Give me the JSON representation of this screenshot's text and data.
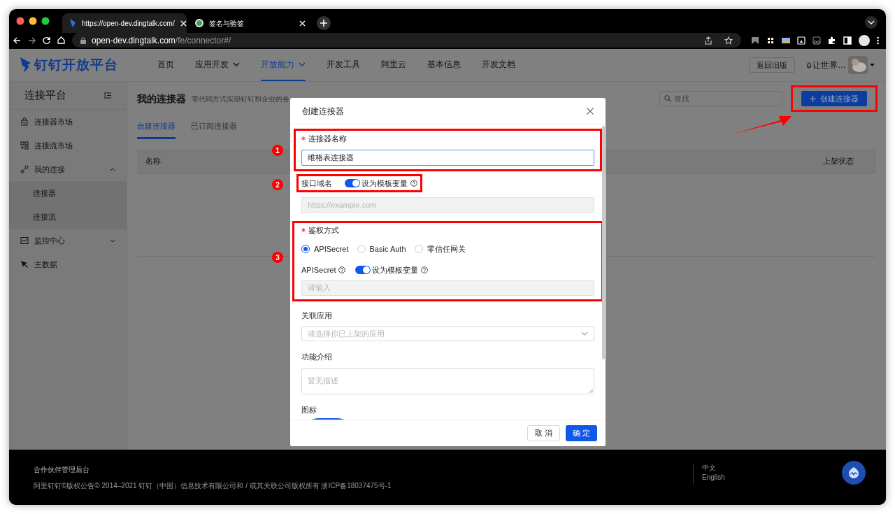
{
  "browser": {
    "tabs": [
      {
        "title": "https://open-dev.dingtalk.com/",
        "selected": true
      },
      {
        "title": "签名与验签",
        "selected": false
      }
    ],
    "url": {
      "host": "open-dev.dingtalk.com",
      "path": "/fe/connector#/"
    }
  },
  "header": {
    "logo": "钉钉开放平台",
    "nav": [
      {
        "label": "首页",
        "caret": false,
        "selected": false
      },
      {
        "label": "应用开发",
        "caret": true,
        "selected": false
      },
      {
        "label": "开放能力",
        "caret": true,
        "selected": true
      },
      {
        "label": "开发工具",
        "caret": false,
        "selected": false
      },
      {
        "label": "阿里云",
        "caret": false,
        "selected": false
      },
      {
        "label": "基本信息",
        "caret": false,
        "selected": false
      },
      {
        "label": "开发文档",
        "caret": false,
        "selected": false
      }
    ],
    "old_version_button": "返回旧版",
    "user_name": "让世界…"
  },
  "sidebar": {
    "title": "连接平台",
    "items": [
      {
        "label": "连接器市场"
      },
      {
        "label": "连接流市场"
      },
      {
        "label": "我的连接",
        "expanded": true,
        "children": [
          {
            "label": "连接器"
          },
          {
            "label": "连接流"
          }
        ]
      },
      {
        "label": "监控中心",
        "expanded": false
      },
      {
        "label": "主数据"
      }
    ]
  },
  "page": {
    "title": "我的连接器",
    "subtitle": "零代码方式实现钉钉和企业的各",
    "tabs": [
      {
        "label": "自建连接器",
        "selected": true
      },
      {
        "label": "已订阅连接器",
        "selected": false
      }
    ],
    "search": {
      "placeholder": "查找"
    },
    "create_button": "创建连接器",
    "table": {
      "columns": [
        "名称",
        "上架状态"
      ]
    }
  },
  "dialog": {
    "title": "创建连接器",
    "name_field": {
      "label": "连接器名称",
      "required": true,
      "value": "维格表连接器"
    },
    "domain_field": {
      "label": "接口域名",
      "toggle": {
        "on": true,
        "label": "设为模板变量"
      },
      "placeholder": "https://example.com"
    },
    "auth": {
      "label": "鉴权方式",
      "required": true,
      "options": [
        {
          "label": "APISecret",
          "selected": true
        },
        {
          "label": "Basic Auth",
          "selected": false
        },
        {
          "label": "零信任网关",
          "selected": false
        }
      ],
      "secret": {
        "label": "APISecret",
        "toggle": {
          "on": true,
          "label": "设为模板变量"
        },
        "placeholder": "请输入"
      }
    },
    "app_field": {
      "label": "关联应用",
      "placeholder": "请选择你已上架的应用"
    },
    "intro_field": {
      "label": "功能介绍",
      "placeholder": "暂无描述"
    },
    "icon_field": {
      "label": "图标"
    },
    "buttons": {
      "cancel": "取 消",
      "ok": "确 定"
    }
  },
  "annotations": {
    "markers": [
      "1",
      "2",
      "3"
    ]
  },
  "footer": {
    "title": "合作伙伴管理后台",
    "copyright": "阿里钉钉©版权公告© 2014–2021 钉钉（中国）信息技术有限公司和 / 或其关联公司版权所有 浙ICP备18037475号-1",
    "languages": [
      "中文",
      "English"
    ]
  }
}
